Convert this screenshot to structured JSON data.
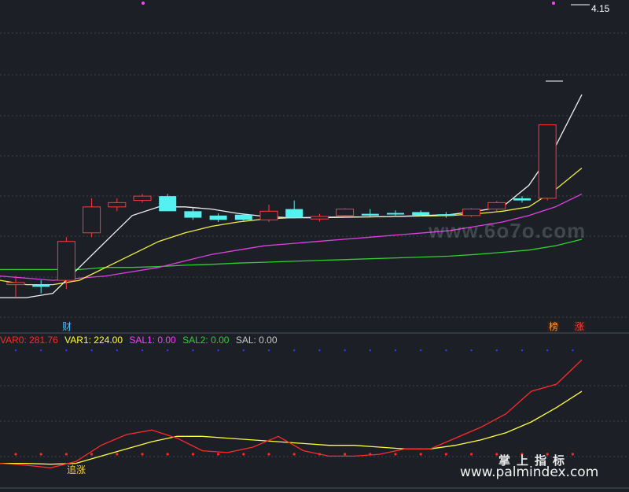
{
  "chart_data": [
    {
      "type": "candlestick",
      "price_label": "4.15",
      "candles": [
        {
          "o": 3.52,
          "c": 3.525,
          "h": 3.54,
          "l": 3.49,
          "color": "up"
        },
        {
          "o": 3.52,
          "c": 3.515,
          "h": 3.53,
          "l": 3.5,
          "color": "down"
        },
        {
          "o": 3.53,
          "c": 3.62,
          "h": 3.63,
          "l": 3.51,
          "color": "up"
        },
        {
          "o": 3.64,
          "c": 3.7,
          "h": 3.72,
          "l": 3.63,
          "color": "up"
        },
        {
          "o": 3.7,
          "c": 3.71,
          "h": 3.72,
          "l": 3.69,
          "color": "up"
        },
        {
          "o": 3.715,
          "c": 3.725,
          "h": 3.73,
          "l": 3.71,
          "color": "up"
        },
        {
          "o": 3.725,
          "c": 3.69,
          "h": 3.73,
          "l": 3.69,
          "color": "down"
        },
        {
          "o": 3.69,
          "c": 3.675,
          "h": 3.7,
          "l": 3.67,
          "color": "down"
        },
        {
          "o": 3.68,
          "c": 3.67,
          "h": 3.685,
          "l": 3.665,
          "color": "down"
        },
        {
          "o": 3.682,
          "c": 3.67,
          "h": 3.685,
          "l": 3.668,
          "color": "down"
        },
        {
          "o": 3.67,
          "c": 3.69,
          "h": 3.705,
          "l": 3.665,
          "color": "up"
        },
        {
          "o": 3.695,
          "c": 3.675,
          "h": 3.715,
          "l": 3.673,
          "color": "down"
        },
        {
          "o": 3.672,
          "c": 3.678,
          "h": 3.684,
          "l": 3.666,
          "color": "up"
        },
        {
          "o": 3.68,
          "c": 3.695,
          "h": 3.697,
          "l": 3.677,
          "color": "up"
        },
        {
          "o": 3.684,
          "c": 3.68,
          "h": 3.695,
          "l": 3.677,
          "color": "down"
        },
        {
          "o": 3.686,
          "c": 3.683,
          "h": 3.692,
          "l": 3.68,
          "color": "down"
        },
        {
          "o": 3.688,
          "c": 3.681,
          "h": 3.692,
          "l": 3.678,
          "color": "down"
        },
        {
          "o": 3.683,
          "c": 3.68,
          "h": 3.688,
          "l": 3.675,
          "color": "down"
        },
        {
          "o": 3.68,
          "c": 3.695,
          "h": 3.697,
          "l": 3.677,
          "color": "up"
        },
        {
          "o": 3.695,
          "c": 3.71,
          "h": 3.714,
          "l": 3.69,
          "color": "up"
        },
        {
          "o": 3.715,
          "c": 3.72,
          "h": 3.725,
          "l": 3.71,
          "color": "down"
        },
        {
          "o": 3.72,
          "c": 3.89,
          "h": 3.89,
          "l": 3.715,
          "color": "up"
        }
      ],
      "ma_white": [
        3.49,
        3.49,
        3.5,
        3.56,
        3.62,
        3.68,
        3.7,
        3.7,
        3.695,
        3.685,
        3.678,
        3.675,
        3.675,
        3.676,
        3.677,
        3.678,
        3.68,
        3.682,
        3.69,
        3.7,
        3.75,
        3.84,
        3.96
      ],
      "ma_yellow": [
        3.53,
        3.52,
        3.52,
        3.53,
        3.56,
        3.59,
        3.62,
        3.64,
        3.655,
        3.665,
        3.672,
        3.675,
        3.676,
        3.677,
        3.677,
        3.678,
        3.679,
        3.68,
        3.684,
        3.69,
        3.7,
        3.74,
        3.79
      ],
      "ma_magenta": [
        3.54,
        3.535,
        3.53,
        3.535,
        3.54,
        3.55,
        3.56,
        3.575,
        3.59,
        3.6,
        3.61,
        3.615,
        3.62,
        3.625,
        3.63,
        3.635,
        3.64,
        3.645,
        3.655,
        3.665,
        3.68,
        3.7,
        3.73
      ],
      "ma_green": [
        3.555,
        3.555,
        3.555,
        3.555,
        3.56,
        3.56,
        3.562,
        3.565,
        3.567,
        3.57,
        3.572,
        3.574,
        3.576,
        3.578,
        3.58,
        3.582,
        3.584,
        3.586,
        3.59,
        3.595,
        3.6,
        3.61,
        3.625
      ],
      "markers": [
        {
          "index": 2,
          "text": "财",
          "color": "#40c8ff"
        },
        {
          "index": 21,
          "text": "榜",
          "color": "#ff9f3a"
        },
        {
          "index": 22,
          "text": "涨",
          "color": "#ff4040"
        }
      ]
    },
    {
      "type": "line",
      "legend": [
        {
          "name": "VAR0",
          "value": "281.76",
          "color": "#ff2a2a"
        },
        {
          "name": "VAR1",
          "value": "224.00",
          "color": "#ffff3a"
        },
        {
          "name": "SAL1",
          "value": "0.00",
          "color": "#ff38ff"
        },
        {
          "name": "SAL2",
          "value": "0.00",
          "color": "#30d030"
        },
        {
          "name": "SAL",
          "value": "0.00",
          "color": "#c8c8c8"
        }
      ],
      "series": [
        {
          "name": "VAR0",
          "color": "#ff2a2a",
          "values": [
            0,
            -2,
            -5,
            2,
            20,
            32,
            37,
            28,
            14,
            12,
            18,
            30,
            14,
            8,
            8,
            10,
            16,
            16,
            28,
            40,
            55,
            80,
            88,
            115
          ]
        },
        {
          "name": "VAR1",
          "color": "#ffff3a",
          "values": [
            0,
            0,
            -1,
            0,
            8,
            16,
            24,
            30,
            30,
            28,
            26,
            24,
            22,
            20,
            20,
            18,
            16,
            16,
            20,
            26,
            34,
            46,
            62,
            80
          ]
        }
      ],
      "ylim": [
        -10,
        130
      ],
      "annotation": "追涨"
    }
  ],
  "watermark_top": "www.6o7o.com",
  "watermark_cn": "掌上指标",
  "watermark_url": "www.palmindex.com"
}
